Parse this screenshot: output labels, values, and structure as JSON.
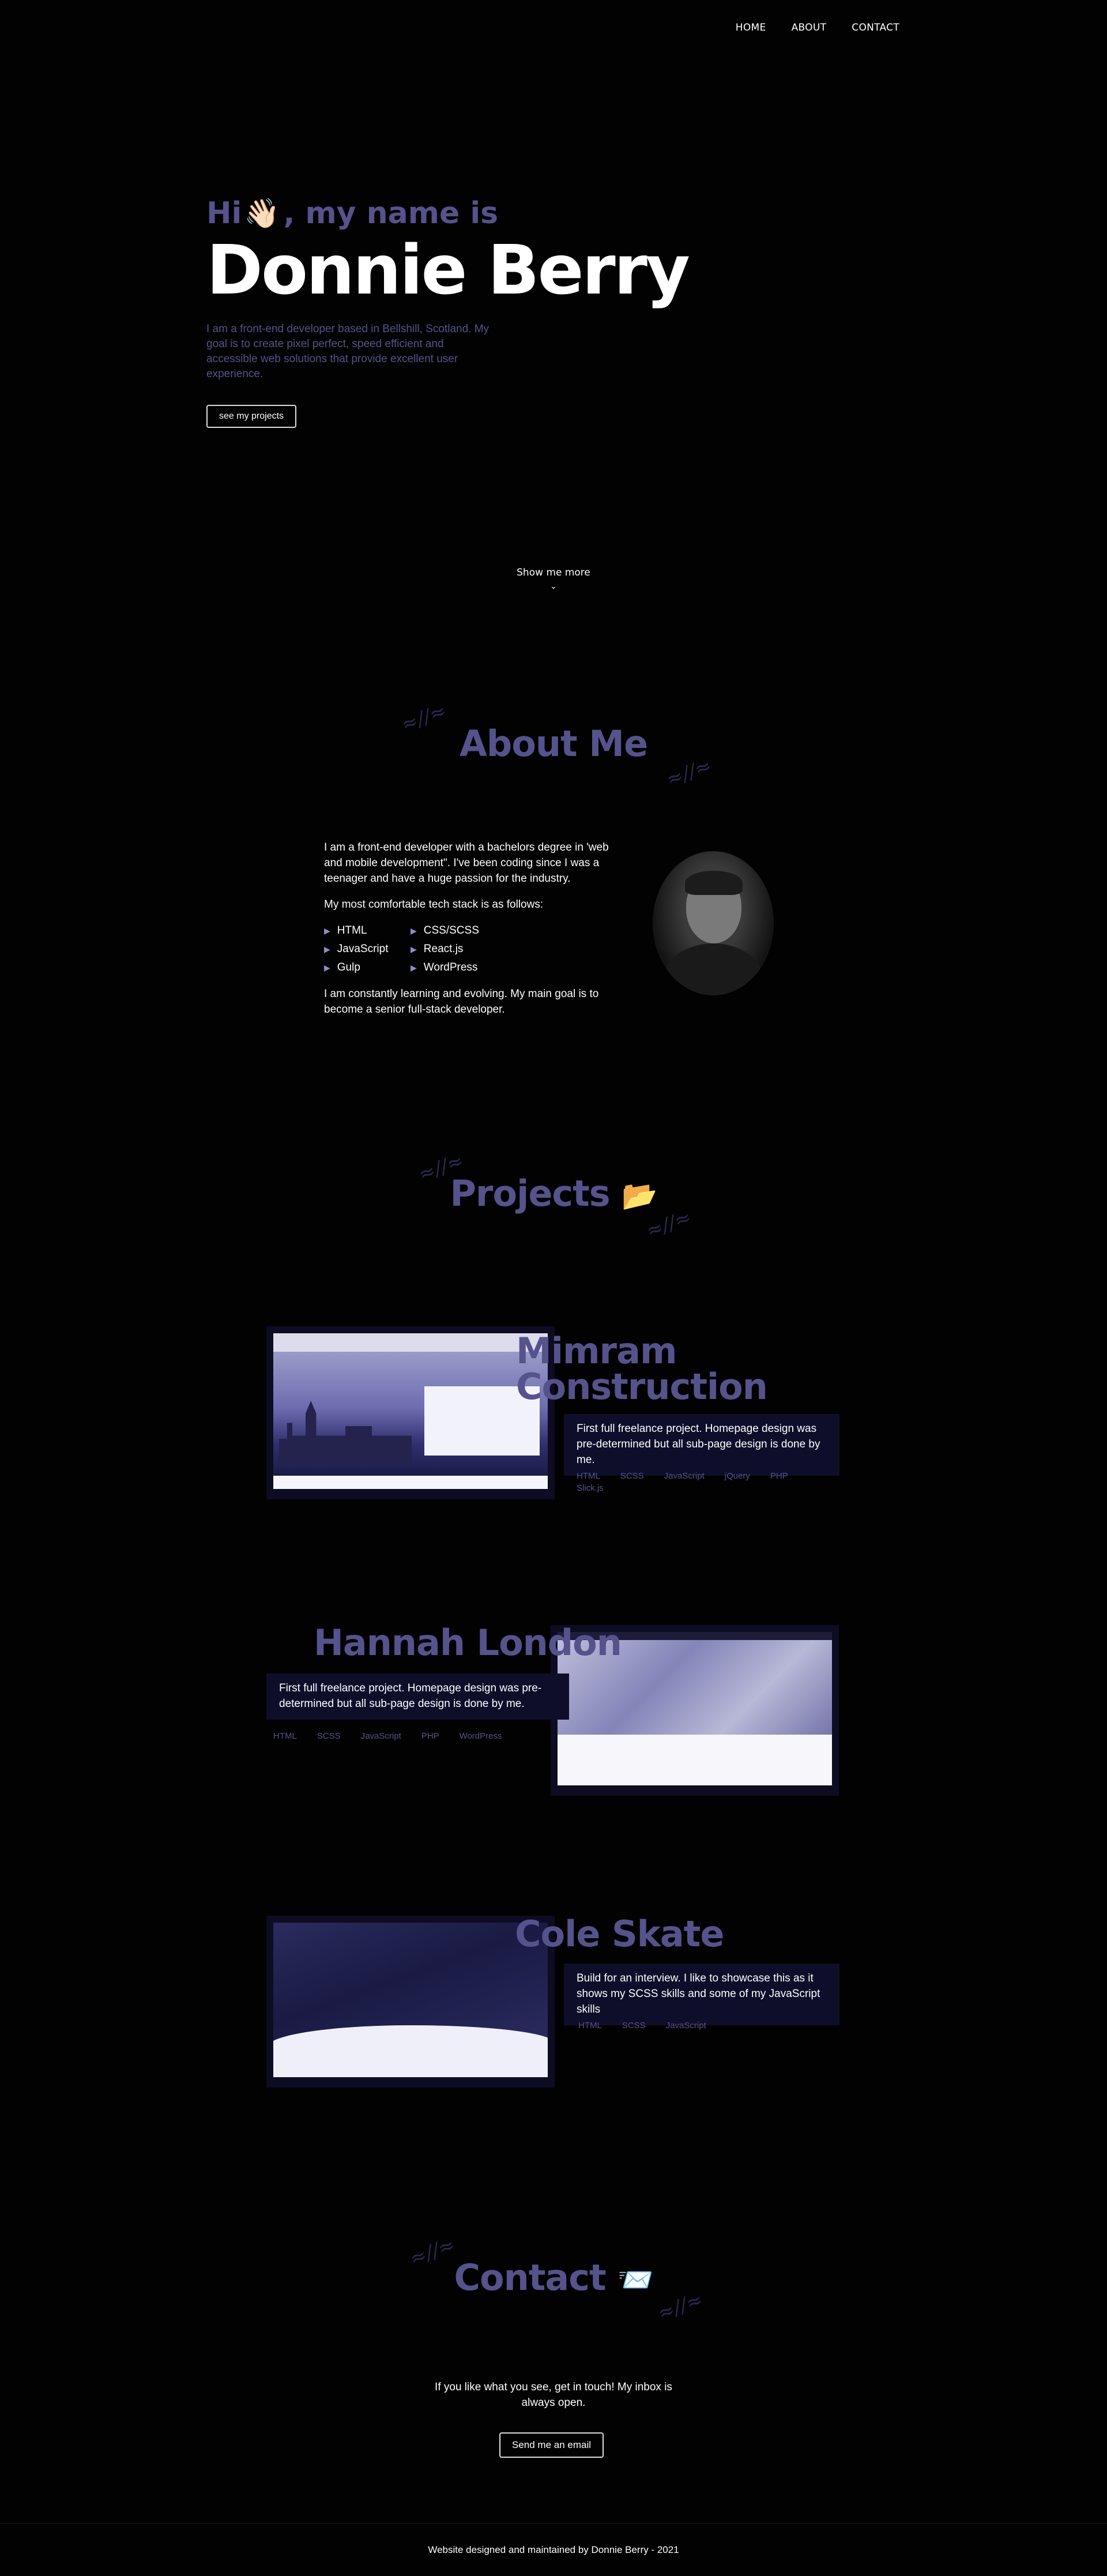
{
  "nav": {
    "items": [
      "HOME",
      "ABOUT",
      "CONTACT"
    ]
  },
  "hero": {
    "greeting_pre": "Hi",
    "greeting_emoji": "👋🏻",
    "greeting_post": ", my name is",
    "name": "Donnie Berry",
    "description": "I am a front-end developer based in Bellshill, Scotland. My goal is to create pixel perfect, speed efficient and accessible web solutions that provide excellent user experience.",
    "button": "see my projects",
    "more": "Show me more",
    "more_icon": "⌄"
  },
  "about": {
    "heading": "About Me",
    "para1": "I am a front-end developer with a bachelors degree in 'web and mobile development\". I've been coding since I was a teenager and have a huge passion for the industry.",
    "para2": "My most comfortable tech stack is as follows:",
    "stack": [
      "HTML",
      "CSS/SCSS",
      "JavaScript",
      "React.js",
      "Gulp",
      "WordPress"
    ],
    "para3": "I am constantly learning and evolving. My main goal is to become a senior full-stack developer."
  },
  "projects": {
    "heading": "Projects",
    "heading_emoji": "📂",
    "items": [
      {
        "title_line1": "Mimram",
        "title_line2": "Construction",
        "description": "First full freelance project. Homepage design was pre-determined but all sub-page design is done by me.",
        "tags": [
          "HTML",
          "SCSS",
          "JavaScript",
          "jQuery",
          "PHP",
          "Slick.js"
        ]
      },
      {
        "title_line1": "Hannah London",
        "description": "First full freelance project. Homepage design was pre-determined but all sub-page design is done by me.",
        "tags": [
          "HTML",
          "SCSS",
          "JavaScript",
          "PHP",
          "WordPress"
        ]
      },
      {
        "title_line1": "Cole Skate",
        "description": "Build for an interview. I like to showcase this as it shows my SCSS skills and some of my JavaScript skills",
        "tags": [
          "HTML",
          "SCSS",
          "JavaScript"
        ]
      }
    ]
  },
  "contact": {
    "heading": "Contact",
    "heading_emoji": "📨",
    "text_line1": "If you like what you see, get in touch! My inbox is",
    "text_line2": "always open.",
    "button": "Send me an email"
  },
  "footer": {
    "text": "Website designed and maintained by Donnie Berry - 2021"
  },
  "colors": {
    "accent": "#55528c",
    "background": "#020202",
    "panel": "#0f0e2a"
  }
}
